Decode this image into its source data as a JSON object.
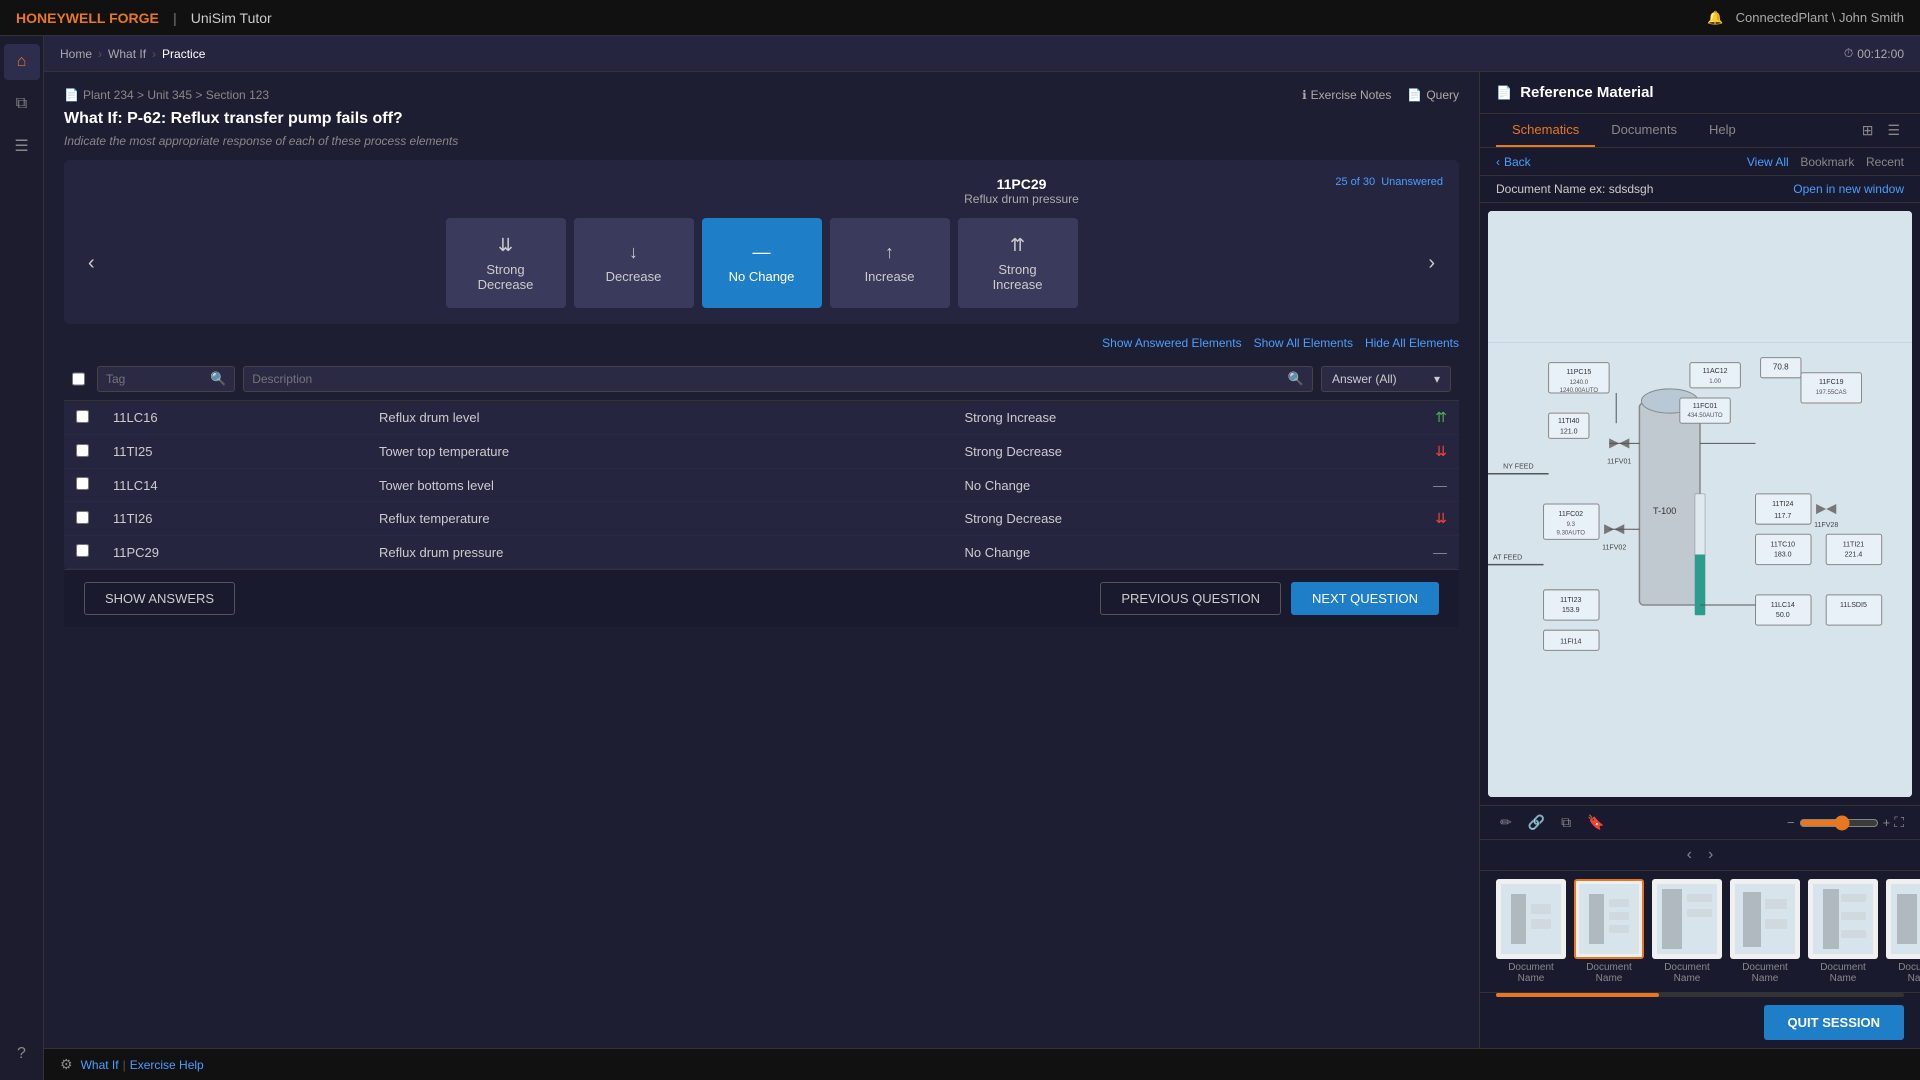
{
  "app": {
    "brand": "HONEYWELL FORGE",
    "divider": "|",
    "app_name": "UniSim Tutor",
    "user": "ConnectedPlant \\ John Smith"
  },
  "topbar": {
    "notification_icon": "🔔"
  },
  "sidebar": {
    "icons": [
      {
        "name": "home-icon",
        "symbol": "⌂"
      },
      {
        "name": "layers-icon",
        "symbol": "⧉"
      },
      {
        "name": "document-icon",
        "symbol": "☰"
      },
      {
        "name": "help-icon",
        "symbol": "?"
      }
    ]
  },
  "secondary_nav": {
    "timer": "00:12:00",
    "timer_icon": "⏱"
  },
  "breadcrumb": {
    "items": [
      "Home",
      "What If",
      "Practice"
    ]
  },
  "exercise": {
    "plant_path": "Plant 234 > Unit 345 > Section 123",
    "exercise_notes_label": "Exercise Notes",
    "query_label": "Query",
    "question": "What If: P-62: Reflux transfer pump fails off?",
    "instruction": "Indicate the most appropriate response of each of these process elements",
    "progress": "25 of 30",
    "unanswered": "Unanswered",
    "card_tag": "11PC29",
    "card_desc": "Reflux drum pressure"
  },
  "response_options": [
    {
      "key": "strong-decrease",
      "label": "Strong\nDecrease",
      "icon": "⇊",
      "selected": false
    },
    {
      "key": "decrease",
      "label": "Decrease",
      "icon": "↓",
      "selected": false
    },
    {
      "key": "no-change",
      "label": "No Change",
      "icon": "—",
      "selected": true
    },
    {
      "key": "increase",
      "label": "Increase",
      "icon": "↑",
      "selected": false
    },
    {
      "key": "strong-increase",
      "label": "Strong\nIncrease",
      "icon": "⇈",
      "selected": false
    }
  ],
  "filter_links": {
    "show_answered": "Show Answered Elements",
    "show_all": "Show All Elements",
    "hide_all": "Hide All Elements"
  },
  "table": {
    "columns": [
      "",
      "Tag",
      "Description",
      "Answer (All)"
    ],
    "rows": [
      {
        "tag": "11LC16",
        "description": "Reflux drum level",
        "answer": "Strong Increase",
        "answer_dir": "up"
      },
      {
        "tag": "11TI25",
        "description": "Tower top temperature",
        "answer": "Strong Decrease",
        "answer_dir": "down"
      },
      {
        "tag": "11LC14",
        "description": "Tower bottoms level",
        "answer": "No Change",
        "answer_dir": "nochange"
      },
      {
        "tag": "11TI26",
        "description": "Reflux temperature",
        "answer": "Strong Decrease",
        "answer_dir": "down"
      },
      {
        "tag": "11PC29",
        "description": "Reflux drum pressure",
        "answer": "No Change",
        "answer_dir": "nochange"
      }
    ],
    "answer_filter_label": "Answer (All)",
    "tag_placeholder": "Tag",
    "desc_placeholder": "Description"
  },
  "buttons": {
    "show_answers": "SHOW ANSWERS",
    "previous_question": "PREVIOUS QUESTION",
    "next_question": "NEXT QUESTION"
  },
  "footer": {
    "what_if": "What If",
    "separator": "|",
    "exercise_help": "Exercise Help",
    "settings_icon": "⚙"
  },
  "reference_panel": {
    "title": "Reference Material",
    "tabs": [
      "Schematics",
      "Documents",
      "Help"
    ],
    "active_tab": "Schematics",
    "back_label": "Back",
    "view_all": "View All",
    "bookmark": "Bookmark",
    "recent": "Recent",
    "doc_name": "Document Name ex: sdsdsgh",
    "open_new": "Open in new window",
    "thumbnails": [
      {
        "label": "Document\nName"
      },
      {
        "label": "Document\nName",
        "active": true
      },
      {
        "label": "Document\nName"
      },
      {
        "label": "Document\nName"
      },
      {
        "label": "Document\nName"
      },
      {
        "label": "Document\nName"
      }
    ]
  },
  "quit": {
    "label": "QUIT SESSION"
  },
  "colors": {
    "brand": "#e87722",
    "accent_blue": "#1e7ec8",
    "link_blue": "#4a9eff",
    "selected_btn": "#1e7ec8",
    "increase": "#4caf50",
    "decrease": "#f44336"
  }
}
